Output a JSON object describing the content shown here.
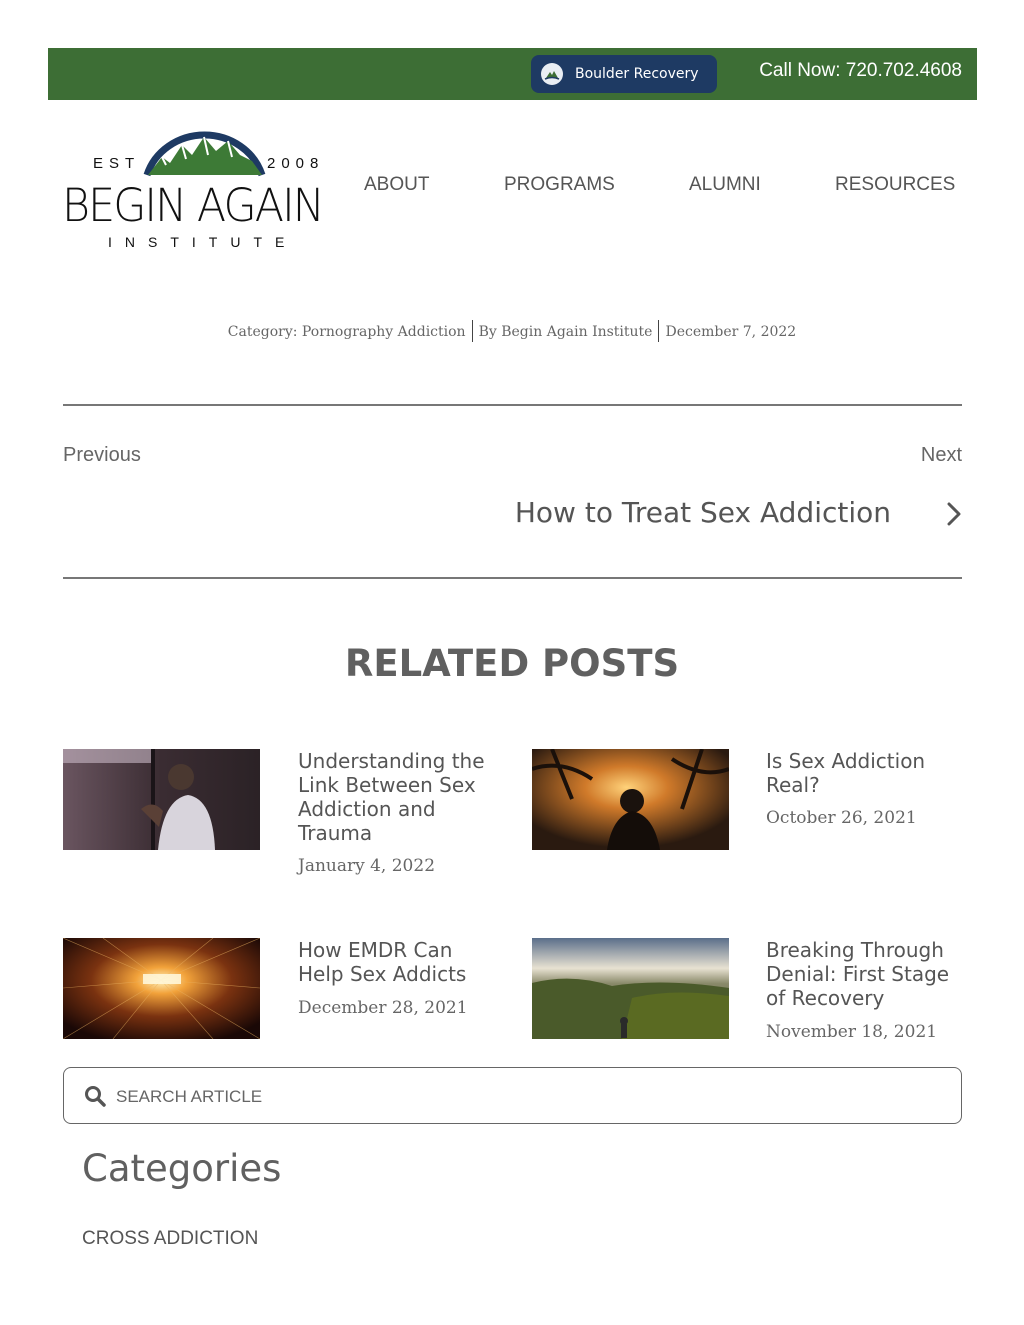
{
  "topbar": {
    "button_label": "Boulder Recovery",
    "call_text": "Call Now: 720.702.4608",
    "bar_color": "#3d6e35",
    "button_color": "#1e3a63"
  },
  "logo": {
    "est": "EST",
    "year": "2008",
    "name": "BEGIN AGAIN",
    "subtitle": "INSTITUTE"
  },
  "nav": {
    "items": [
      "ABOUT",
      "PROGRAMS",
      "ALUMNI",
      "RESOURCES"
    ]
  },
  "meta": {
    "category": "Category: Pornography Addiction",
    "author": "By Begin Again Institute",
    "date": "December 7, 2022"
  },
  "post_nav": {
    "previous_label": "Previous",
    "next_label": "Next",
    "next_title": "How to Treat Sex Addiction",
    "next_icon": "chevron-right-icon"
  },
  "related": {
    "heading": "RELATED POSTS",
    "posts": [
      {
        "title": "Understanding the Link Between Sex Addiction and Trauma",
        "date": "January 4, 2022"
      },
      {
        "title": "Is Sex Addiction Real?",
        "date": "October 26, 2021"
      },
      {
        "title": "How EMDR Can Help Sex Addicts",
        "date": "December 28, 2021"
      },
      {
        "title": "Breaking Through Denial: First Stage of Recovery",
        "date": "November 18, 2021"
      }
    ]
  },
  "search": {
    "placeholder": "SEARCH ARTICLE",
    "icon": "search-icon"
  },
  "categories": {
    "heading": "Categories",
    "items": [
      "CROSS ADDICTION"
    ]
  }
}
